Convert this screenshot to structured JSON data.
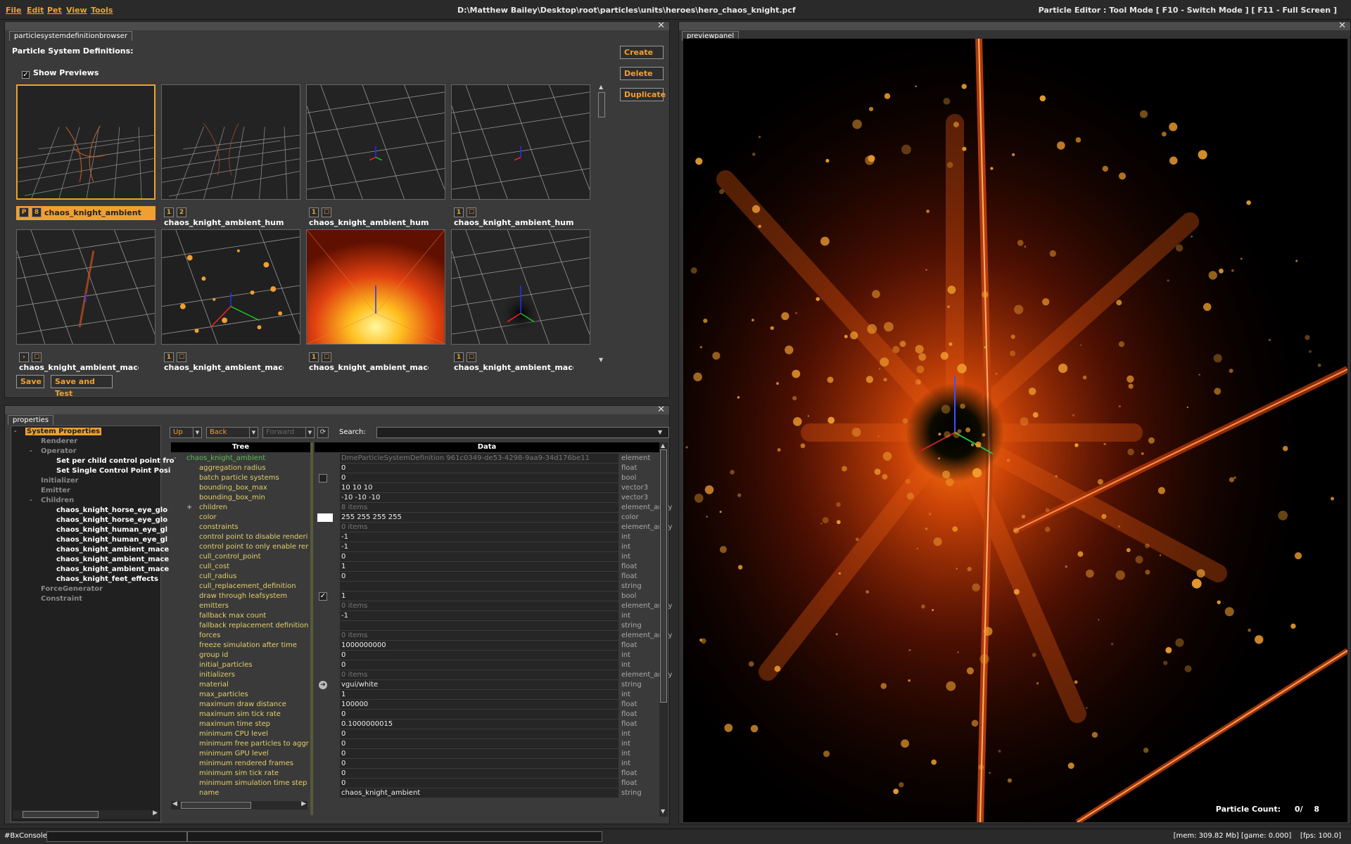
{
  "menubar": {
    "items": [
      "File",
      "Edit",
      "Pet",
      "View",
      "Tools"
    ],
    "file_path": "D:\\Matthew Bailey\\Desktop\\root\\particles\\units\\heroes\\hero_chaos_knight.pcf",
    "mode": "Particle Editor  : Tool Mode [ F10 - Switch Mode ] [ F11 - Full Screen ]"
  },
  "browser": {
    "tab": "particlesystemdefinitionbrowser",
    "heading": "Particle System Definitions:",
    "show_previews": "Show Previews",
    "buttons": {
      "create": "Create",
      "delete": "Delete",
      "duplicate": "Duplicate"
    },
    "items": [
      {
        "name": "chaos_knight_ambient",
        "box1": "P",
        "box2": "8",
        "selected": true
      },
      {
        "name": "chaos_knight_ambient_human_",
        "box1": "1",
        "box2": "2"
      },
      {
        "name": "chaos_knight_ambient_human_",
        "box1": "1",
        "box2": "☐"
      },
      {
        "name": "chaos_knight_ambient_human_",
        "box1": "1",
        "box2": "☐"
      },
      {
        "name": "chaos_knight_ambient_mace",
        "box1": "›",
        "box2": "☐"
      },
      {
        "name": "chaos_knight_ambient_mace_b",
        "box1": "1",
        "box2": "☐"
      },
      {
        "name": "chaos_knight_ambient_mace_c",
        "box1": "1",
        "box2": "☐"
      },
      {
        "name": "chaos_knight_ambient_mace_d",
        "box1": "1",
        "box2": "☐"
      }
    ],
    "save": "Save",
    "save_and_test": "Save and Test"
  },
  "preview": {
    "tab": "previewpanel",
    "particle_count_label": "Particle Count:",
    "particle_count_value": "0/",
    "particle_count_max": "8"
  },
  "properties": {
    "tab": "properties",
    "tree": {
      "system_properties": "System Properties",
      "renderer": "Renderer",
      "operator": "Operator",
      "operator_children": [
        "Set per child control point fro",
        "Set Single Control Point Posi"
      ],
      "initializer": "Initializer",
      "emitter": "Emitter",
      "children": "Children",
      "children_items": [
        "chaos_knight_horse_eye_glo",
        "chaos_knight_horse_eye_glo",
        "chaos_knight_human_eye_gl",
        "chaos_knight_human_eye_gl",
        "chaos_knight_ambient_mace",
        "chaos_knight_ambient_mace",
        "chaos_knight_ambient_mace",
        "chaos_knight_feet_effects"
      ],
      "force_generator": "ForceGenerator",
      "constraint": "Constraint"
    },
    "nav": {
      "up": "Up",
      "back": "Back",
      "forward": "Forward",
      "search_label": "Search:",
      "search_value": ""
    },
    "grid_headers": {
      "tree": "Tree",
      "data": "Data"
    },
    "rows": [
      {
        "name": "chaos_knight_ambient",
        "value": "DmeParticleSystemDefinition 961c0349-de53-4298-9aa9-34d176be11",
        "type": "element",
        "root": true,
        "dim": true
      },
      {
        "name": "aggregation radius",
        "value": "0",
        "type": "float"
      },
      {
        "name": "batch particle systems",
        "value": "0",
        "type": "bool",
        "widget": "box"
      },
      {
        "name": "bounding_box_max",
        "value": "10 10 10",
        "type": "vector3"
      },
      {
        "name": "bounding_box_min",
        "value": "-10 -10 -10",
        "type": "vector3"
      },
      {
        "name": "children",
        "value": "8 items",
        "type": "element_array",
        "plus": true,
        "dim": true
      },
      {
        "name": "color",
        "value": "255 255 255 255",
        "type": "color",
        "widget": "color"
      },
      {
        "name": "constraints",
        "value": "0 items",
        "type": "element_array",
        "dim": true
      },
      {
        "name": "control point to disable renderi",
        "value": "-1",
        "type": "int"
      },
      {
        "name": "control point to only enable rer",
        "value": "-1",
        "type": "int"
      },
      {
        "name": "cull_control_point",
        "value": "0",
        "type": "int"
      },
      {
        "name": "cull_cost",
        "value": "1",
        "type": "float"
      },
      {
        "name": "cull_radius",
        "value": "0",
        "type": "float"
      },
      {
        "name": "cull_replacement_definition",
        "value": "",
        "type": "string"
      },
      {
        "name": "draw through leafsystem",
        "value": "1",
        "type": "bool",
        "widget": "check"
      },
      {
        "name": "emitters",
        "value": "0 items",
        "type": "element_array",
        "dim": true
      },
      {
        "name": "fallback max count",
        "value": "-1",
        "type": "int"
      },
      {
        "name": "fallback replacement definition",
        "value": "",
        "type": "string"
      },
      {
        "name": "forces",
        "value": "0 items",
        "type": "element_array",
        "dim": true
      },
      {
        "name": "freeze simulation after time",
        "value": "1000000000",
        "type": "float"
      },
      {
        "name": "group id",
        "value": "0",
        "type": "int"
      },
      {
        "name": "initial_particles",
        "value": "0",
        "type": "int"
      },
      {
        "name": "initializers",
        "value": "0 items",
        "type": "element_array",
        "dim": true
      },
      {
        "name": "material",
        "value": "vgui/white",
        "type": "string",
        "widget": "arrow"
      },
      {
        "name": "max_particles",
        "value": "1",
        "type": "int"
      },
      {
        "name": "maximum draw distance",
        "value": "100000",
        "type": "float"
      },
      {
        "name": "maximum sim tick rate",
        "value": "0",
        "type": "float"
      },
      {
        "name": "maximum time step",
        "value": "0.1000000015",
        "type": "float"
      },
      {
        "name": "minimum CPU level",
        "value": "0",
        "type": "int"
      },
      {
        "name": "minimum free particles to aggr",
        "value": "0",
        "type": "int"
      },
      {
        "name": "minimum GPU level",
        "value": "0",
        "type": "int"
      },
      {
        "name": "minimum rendered frames",
        "value": "0",
        "type": "int"
      },
      {
        "name": "minimum sim tick rate",
        "value": "0",
        "type": "float"
      },
      {
        "name": "minimum simulation time step",
        "value": "0",
        "type": "float"
      },
      {
        "name": "name",
        "value": "chaos_knight_ambient",
        "type": "string"
      }
    ]
  },
  "statusbar": {
    "console_label": "#BxConsole",
    "status_text": "[mem: 309.82 Mb] [game: 0.000]    [fps: 100.0]"
  },
  "colors": {
    "accent": "#f0a030",
    "property_name": "#e3cf6a",
    "root_name": "#58c050"
  }
}
